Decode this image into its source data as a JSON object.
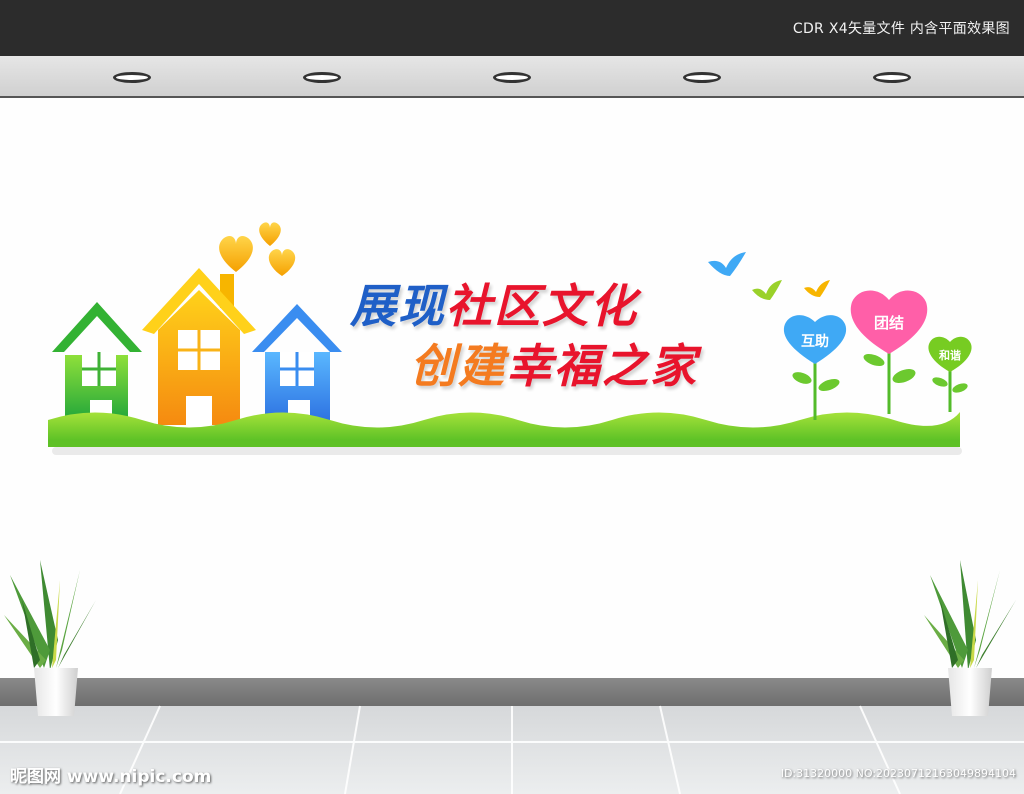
{
  "header": {
    "format_label": "CDR X4矢量文件  内含平面效果图"
  },
  "sign": {
    "title_line1": {
      "part1": "展现",
      "part2": "社区文化"
    },
    "title_line2": {
      "part1": "创建",
      "part2": "幸福之家"
    },
    "hearts": [
      {
        "label": "互助",
        "color": "#3fa9f5"
      },
      {
        "label": "团结",
        "color": "#ff5fa8"
      },
      {
        "label": "和谐",
        "color": "#77cc22"
      }
    ],
    "house_colors": [
      "#33b233",
      "#f7b500",
      "#3a8df0"
    ]
  },
  "colors": {
    "title_blue": "#1f5fc7",
    "title_red": "#e8142c",
    "title_orange": "#f47b20",
    "grass": "#6fce2c",
    "wall": "#fefefe",
    "top_bar": "#2c2c2c"
  },
  "icons": [
    "ceiling-light-icon",
    "heart-icon",
    "bird-icon",
    "snake-plant-icon",
    "house-icon"
  ],
  "watermark": {
    "site": "昵图网 www.nipic.com",
    "id": "ID:31320000 NO:20230712163049894104"
  }
}
